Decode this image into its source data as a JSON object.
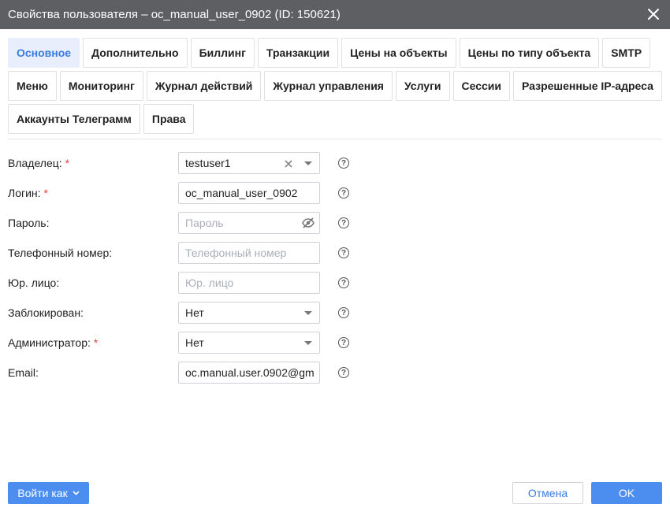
{
  "window": {
    "title": "Свойства пользователя – oc_manual_user_0902 (ID: 150621)",
    "close_icon": "close-icon"
  },
  "tabs": {
    "row1": [
      "Основное",
      "Дополнительно",
      "Биллинг",
      "Транзакции",
      "Цены на объекты",
      "Цены по типу объекта",
      "SMTP"
    ],
    "row2": [
      "Меню",
      "Мониторинг",
      "Журнал действий",
      "Журнал управления",
      "Услуги",
      "Сессии",
      "Разрешенные IP-адреса"
    ],
    "row3": [
      "Аккаунты Телеграмм",
      "Права"
    ],
    "active": "Основное"
  },
  "form": {
    "owner": {
      "label": "Владелец:",
      "value": "testuser1"
    },
    "login": {
      "label": "Логин:",
      "value": "oc_manual_user_0902"
    },
    "password": {
      "label": "Пароль:",
      "placeholder": "Пароль"
    },
    "phone": {
      "label": "Телефонный номер:",
      "placeholder": "Телефонный номер"
    },
    "legal": {
      "label": "Юр. лицо:",
      "placeholder": "Юр. лицо"
    },
    "blocked": {
      "label": "Заблокирован:",
      "value": "Нет"
    },
    "admin": {
      "label": "Администратор:",
      "value": "Нет"
    },
    "email": {
      "label": "Email:",
      "value": "oc.manual.user.0902@gm"
    },
    "required_mark": "*",
    "help_glyph": "?"
  },
  "footer": {
    "login_as": "Войти как",
    "cancel": "Отмена",
    "ok": "OK"
  },
  "colors": {
    "titlebar": "#5d5f63",
    "accent": "#4b8ef0",
    "active_tab_bg": "#e8eefb",
    "required": "#e0453a"
  }
}
